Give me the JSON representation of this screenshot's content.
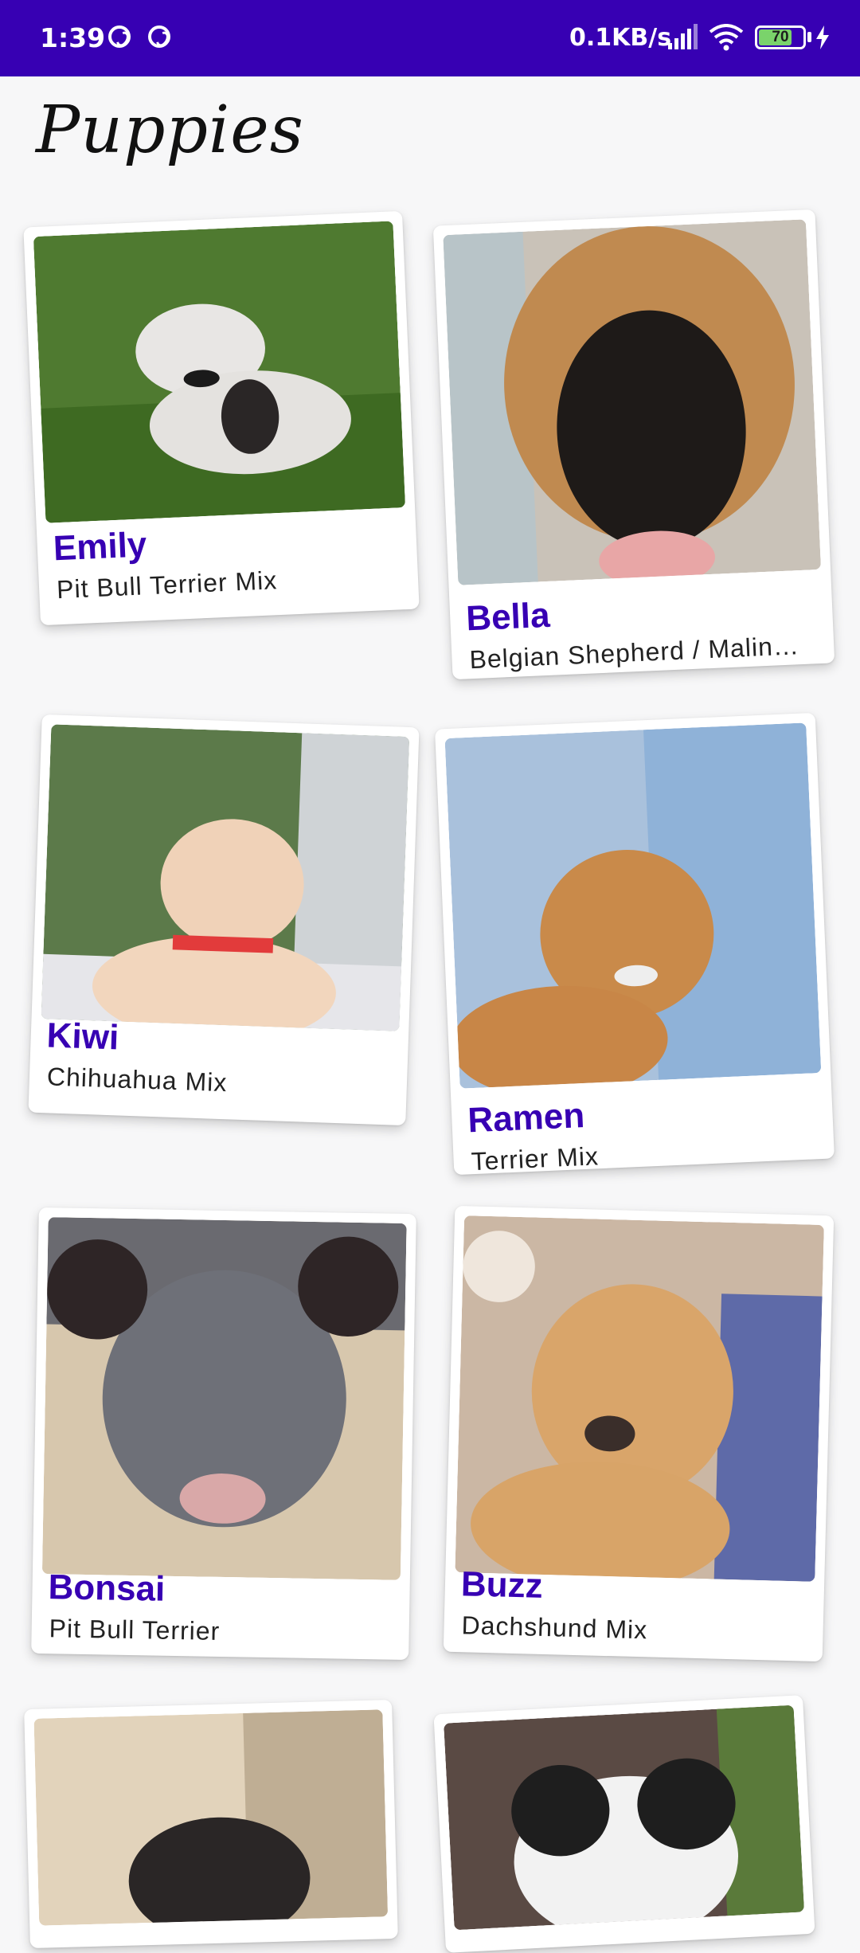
{
  "status_bar": {
    "time": "1:39",
    "net_speed": "0.1KB/s",
    "battery_level": "70",
    "battery_fraction": 0.7,
    "icons": [
      "sync-icon",
      "sync-icon",
      "signal-icon",
      "wifi-icon",
      "battery-icon",
      "charging-icon"
    ]
  },
  "page": {
    "title": "Puppies"
  },
  "colors": {
    "accent": "#3700b3",
    "background": "#f7f7f8",
    "card": "#ffffff"
  },
  "puppies": [
    {
      "name": "Emily",
      "breed": "Pit Bull Terrier Mix"
    },
    {
      "name": "Bella",
      "breed": "Belgian Shepherd / Malinois Mix"
    },
    {
      "name": "Kiwi",
      "breed": "Chihuahua Mix"
    },
    {
      "name": "Ramen",
      "breed": "Terrier Mix"
    },
    {
      "name": "Bonsai",
      "breed": "Pit Bull Terrier"
    },
    {
      "name": "Buzz",
      "breed": "Dachshund Mix"
    },
    {
      "name": "",
      "breed": ""
    },
    {
      "name": "",
      "breed": ""
    }
  ]
}
